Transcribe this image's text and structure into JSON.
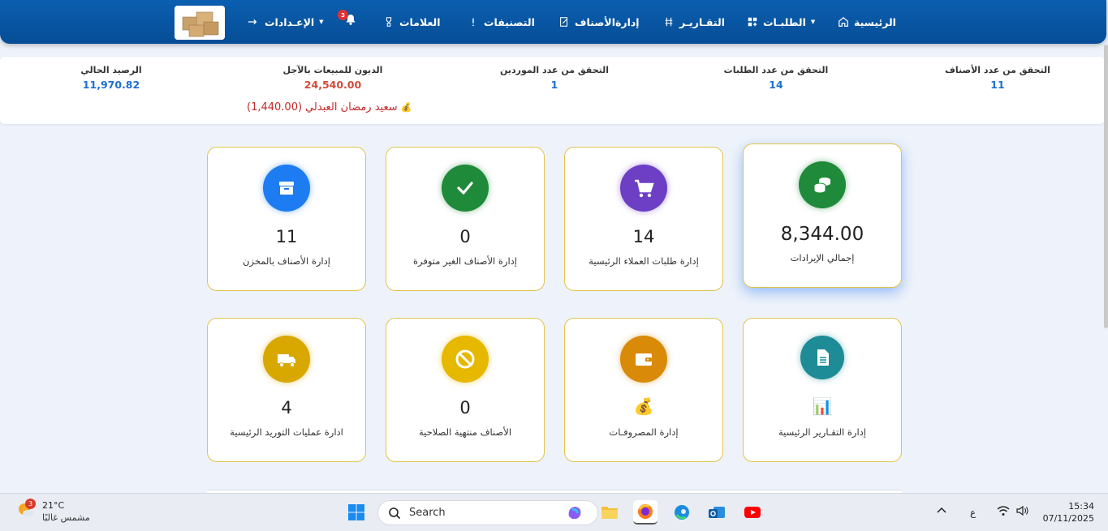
{
  "nav": {
    "home": "الرئيسية",
    "orders": "الطلبـات",
    "reports": "التقـاريـر",
    "items_mgmt": "إدارةالأصناف",
    "categories": "التصنيفات",
    "brands": "العلامات",
    "notifications_count": "3",
    "settings": "الإعـدادات"
  },
  "stats": {
    "items_count_label": "التحقق من عدد الأصناف",
    "items_count": "11",
    "orders_count_label": "التحقق من عدد الطلبات",
    "orders_count": "14",
    "suppliers_count_label": "التحقق من عدد الموردين",
    "suppliers_count": "1",
    "credit_debts_label": "الديون للمبيعات بالآجل",
    "credit_debts": "24,540.00",
    "balance_label": "الرصيد الحالي",
    "balance": "11,970.82",
    "debtor_name": "سعيد رمضان العبدلي",
    "debtor_amount": "(1,440.00)"
  },
  "cards": [
    {
      "value": "8,344.00",
      "label": "إجمالي الإيرادات",
      "color": "#1f8a3a"
    },
    {
      "value": "14",
      "label": "إدارة طلبات العملاء الرئيسية",
      "color": "#6c3fc4"
    },
    {
      "value": "0",
      "label": "إدارة الأصناف الغير متوفرة",
      "color": "#1f8a3a"
    },
    {
      "value": "11",
      "label": "إدارة الأصناف بالمخزن",
      "color": "#1d7cf2"
    },
    {
      "value": "",
      "label": "إدارة التقـارير الرئيسية",
      "color": "#1d8c96"
    },
    {
      "value": "",
      "label": "إدارة المصروفـات",
      "color": "#d98a09"
    },
    {
      "value": "0",
      "label": "الأصناف منتهية الصلاحية",
      "color": "#e6b800"
    },
    {
      "value": "4",
      "label": "ادارة عمليات التوريد الرئيسية",
      "color": "#d9a800"
    }
  ],
  "taskbar": {
    "weather_badge": "3",
    "temperature": "21°C",
    "condition": "مشمس غالبًا",
    "search_placeholder": "Search",
    "lang": "ع",
    "time": "15:34",
    "date": "07/11/2025"
  }
}
